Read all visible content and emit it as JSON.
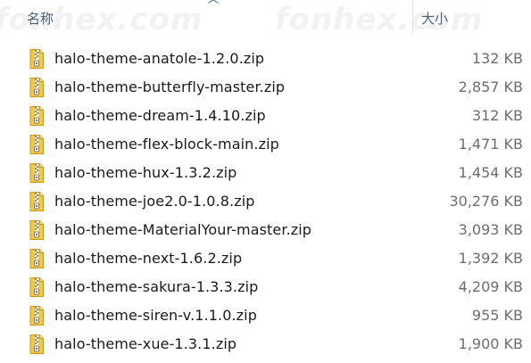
{
  "watermark": [
    "fonhex.com",
    "fonhex.com"
  ],
  "header": {
    "name_label": "名称",
    "size_label": "大小",
    "sort_glyph": "^"
  },
  "files": [
    {
      "name": "halo-theme-anatole-1.2.0.zip",
      "size": "132 KB"
    },
    {
      "name": "halo-theme-butterfly-master.zip",
      "size": "2,857 KB"
    },
    {
      "name": "halo-theme-dream-1.4.10.zip",
      "size": "312 KB"
    },
    {
      "name": "halo-theme-flex-block-main.zip",
      "size": "1,471 KB"
    },
    {
      "name": "halo-theme-hux-1.3.2.zip",
      "size": "1,454 KB"
    },
    {
      "name": "halo-theme-joe2.0-1.0.8.zip",
      "size": "30,276 KB"
    },
    {
      "name": "halo-theme-MaterialYour-master.zip",
      "size": "3,093 KB"
    },
    {
      "name": "halo-theme-next-1.6.2.zip",
      "size": "1,392 KB"
    },
    {
      "name": "halo-theme-sakura-1.3.3.zip",
      "size": "4,209 KB"
    },
    {
      "name": "halo-theme-siren-v.1.1.0.zip",
      "size": "955 KB"
    },
    {
      "name": "halo-theme-xue-1.3.1.zip",
      "size": "1,900 KB"
    }
  ],
  "icon": "zip-archive-icon",
  "colors": {
    "header_text": "#4c607a",
    "file_text": "#1a1a1a",
    "size_text": "#6d6d6d",
    "zip_yellow": "#f5c742"
  }
}
